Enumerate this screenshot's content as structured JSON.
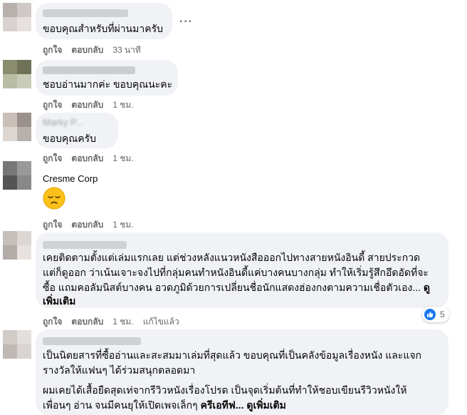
{
  "colors": {
    "bubble": "#f0f2f5",
    "muted": "#65676b",
    "like_blue": "#1877f2"
  },
  "comments": [
    {
      "author": "",
      "text_lines": [
        "ขอบคุณสำหรับที่ผ่านมาครับ"
      ],
      "like": "ถูกใจ",
      "reply": "ตอบกลับ",
      "time": "33 นาที"
    },
    {
      "author": "",
      "text_lines": [
        "ชอบอ่านมากค่ะ ขอบคุณนะคะ"
      ],
      "like": "ถูกใจ",
      "reply": "ตอบกลับ",
      "time": "1 ชม."
    },
    {
      "author": "Marky P...",
      "text_lines": [
        "ขอบคุณครับ"
      ],
      "like": "ถูกใจ",
      "reply": "ตอบกลับ",
      "time": "1 ชม."
    },
    {
      "author": "Cresme Corp",
      "emoji": "pensive-face",
      "like": "ถูกใจ",
      "reply": "ตอบกลับ",
      "time": "1 ชม."
    },
    {
      "author": "",
      "text_lines": [
        "เคยติดตามตั้งแต่เล่มแรกเลย แต่ช่วงหลังแนวหนังสือออกไปทางสายหนังอินดี้ สายประกวด",
        "แต่ก็ดูออก ว่าเน้นเจาะจงไปที่กลุ่มคนทำหนังอินดี้แค่บางคนบางกลุ่ม ทำให้เริ่มรู้สึกอึดอัดที่จะ",
        "ซื้อ แถมคอลัมนิสต์บางคน อวดภูมิด้วยการเปลี่ยนชื่อนักแสดงฮ่องกงตามความเชื่อตัวเอง..."
      ],
      "see_more": "ดู",
      "see_more_2": "เพิ่มเติม",
      "like": "ถูกใจ",
      "reply": "ตอบกลับ",
      "time": "1 ชม.",
      "edited": "แก้ไขแล้ว",
      "reactions": {
        "icon": "thumbs-up-icon",
        "count": "5"
      }
    },
    {
      "author": "",
      "para1": [
        "เป็นนิตยสารที่ซื้ออ่านและสะสมมาเล่มที่สุดแล้ว ขอบคุณที่เป็นคลังข้อมูลเรื่องหนัง และแจก",
        "รางวัลให้แฟนๆ ได้ร่วมสนุกตลอดมา"
      ],
      "para2": [
        "ผมเคยได้เสื้อยืดสุดเท่จากรีวิวหนังเรื่องโปรด เป็นจุดเริ่มต้นที่ทำให้ชอบเขียนรีวิวหนังให้",
        "เพื่อนๆ อ่าน จนมีคนยุให้เปิดเพจเล็กๆ"
      ],
      "tail_bold": "ครีเอทีฟ...",
      "see_more": "ดูเพิ่มเติม"
    }
  ]
}
